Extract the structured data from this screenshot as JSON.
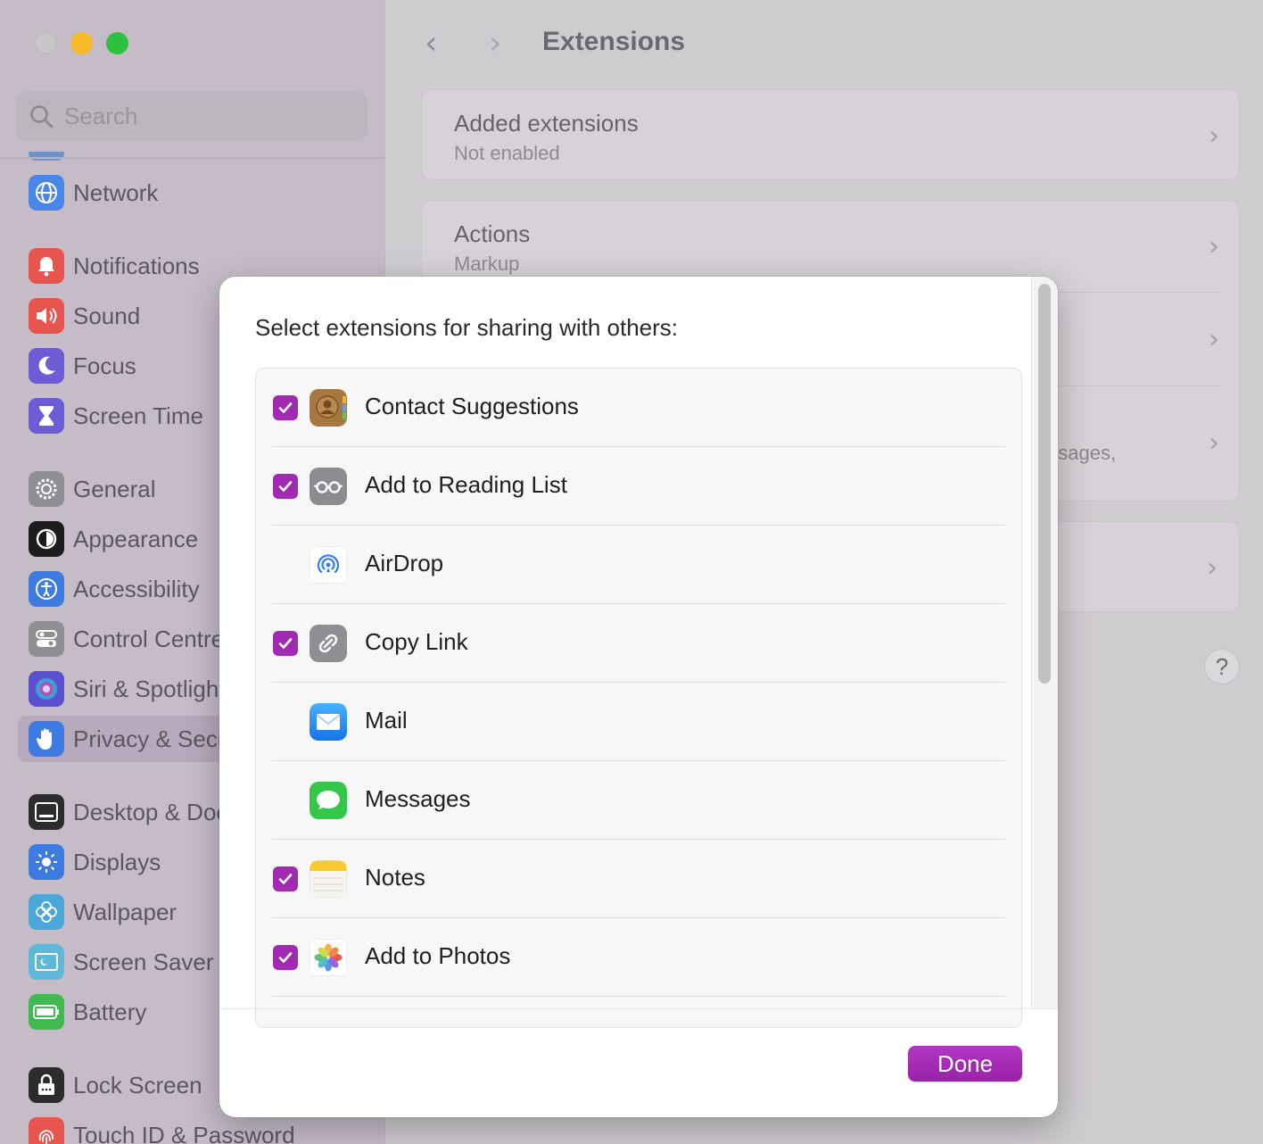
{
  "window": {
    "title": "Extensions",
    "search_placeholder": "Search"
  },
  "sidebar": {
    "items": [
      {
        "label": "Network",
        "icon": "globe-icon",
        "color": "#4a86e8"
      },
      {
        "label": "Notifications",
        "icon": "bell-icon",
        "color": "#e8554e"
      },
      {
        "label": "Sound",
        "icon": "speaker-icon",
        "color": "#e8554e"
      },
      {
        "label": "Focus",
        "icon": "moon-icon",
        "color": "#6e5bd6"
      },
      {
        "label": "Screen Time",
        "icon": "hourglass-icon",
        "color": "#6e5bd6"
      },
      {
        "label": "General",
        "icon": "gear-icon",
        "color": "#8e8e93"
      },
      {
        "label": "Appearance",
        "icon": "appearance-icon",
        "color": "#1c1c1e"
      },
      {
        "label": "Accessibility",
        "icon": "accessibility-icon",
        "color": "#3d7be0"
      },
      {
        "label": "Control Centre",
        "icon": "toggles-icon",
        "color": "#8e8e93"
      },
      {
        "label": "Siri & Spotlight",
        "icon": "siri-icon",
        "color": "#5a4fcf"
      },
      {
        "label": "Privacy & Security",
        "icon": "hand-icon",
        "color": "#3d7be0"
      },
      {
        "label": "Desktop & Dock",
        "icon": "dock-icon",
        "color": "#2c2c2e"
      },
      {
        "label": "Displays",
        "icon": "sun-icon",
        "color": "#3d7be0"
      },
      {
        "label": "Wallpaper",
        "icon": "flower-icon",
        "color": "#4aa8d8"
      },
      {
        "label": "Screen Saver",
        "icon": "screensaver-icon",
        "color": "#5fb8d8"
      },
      {
        "label": "Battery",
        "icon": "battery-icon",
        "color": "#3fb950"
      },
      {
        "label": "Lock Screen",
        "icon": "lock-icon",
        "color": "#2c2c2e"
      },
      {
        "label": "Touch ID & Password",
        "icon": "fingerprint-icon",
        "color": "#e8554e"
      }
    ]
  },
  "main": {
    "rows": [
      {
        "title": "Added extensions",
        "subtitle": "Not enabled"
      },
      {
        "title": "Actions",
        "subtitle": "Markup"
      },
      {
        "title": "",
        "subtitle": ""
      },
      {
        "title": "",
        "subtitle": "essages,"
      },
      {
        "title": "",
        "subtitle": ""
      }
    ],
    "help_label": "?"
  },
  "sheet": {
    "title": "Select extensions for sharing with others:",
    "extensions": [
      {
        "label": "Contact Suggestions",
        "checked": true,
        "icon": "contacts-icon"
      },
      {
        "label": "Add to Reading List",
        "checked": true,
        "icon": "reading-list-icon"
      },
      {
        "label": "AirDrop",
        "checked": false,
        "icon": "airdrop-icon"
      },
      {
        "label": "Copy Link",
        "checked": true,
        "icon": "link-icon"
      },
      {
        "label": "Mail",
        "checked": false,
        "icon": "mail-icon"
      },
      {
        "label": "Messages",
        "checked": false,
        "icon": "messages-icon"
      },
      {
        "label": "Notes",
        "checked": true,
        "icon": "notes-icon"
      },
      {
        "label": "Add to Photos",
        "checked": true,
        "icon": "photos-icon"
      }
    ],
    "done_label": "Done",
    "accent_color": "#a02bb0"
  }
}
